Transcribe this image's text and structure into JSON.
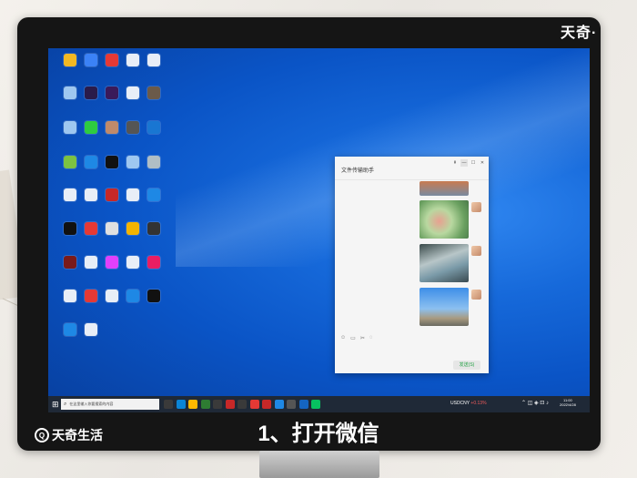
{
  "watermark_top": "天奇·",
  "watermark_bottom": "天奇生活",
  "caption": "1、打开微信",
  "desktop_icons": [
    {
      "label": "",
      "color": "#f2b823"
    },
    {
      "label": "",
      "color": "#3b82f6"
    },
    {
      "label": "",
      "color": "#e53935"
    },
    {
      "label": "",
      "color": "#e8eef7"
    },
    {
      "label": "",
      "color": "#e8eef7"
    },
    {
      "label": "",
      "color": "#9ec7f0"
    },
    {
      "label": "",
      "color": "#2a1b4a"
    },
    {
      "label": "",
      "color": "#3a1a5a"
    },
    {
      "label": "",
      "color": "#e8eef7"
    },
    {
      "label": "",
      "color": "#6b5a4a"
    },
    {
      "label": "",
      "color": "#9ec7f0"
    },
    {
      "label": "",
      "color": "#2ecc40"
    },
    {
      "label": "",
      "color": "#c08a6a"
    },
    {
      "label": "",
      "color": "#555"
    },
    {
      "label": "",
      "color": "#1976d2"
    },
    {
      "label": "",
      "color": "#7cc242"
    },
    {
      "label": "",
      "color": "#1e88e5"
    },
    {
      "label": "",
      "color": "#111"
    },
    {
      "label": "",
      "color": "#9ec7f0"
    },
    {
      "label": "",
      "color": "#b0bec5"
    },
    {
      "label": "",
      "color": "#e8eef7"
    },
    {
      "label": "",
      "color": "#e8eef7"
    },
    {
      "label": "",
      "color": "#c62828"
    },
    {
      "label": "",
      "color": "#e8eef7"
    },
    {
      "label": "",
      "color": "#1e88e5"
    },
    {
      "label": "",
      "color": "#111"
    },
    {
      "label": "",
      "color": "#e53935"
    },
    {
      "label": "",
      "color": "#e0e0e0"
    },
    {
      "label": "",
      "color": "#f4b400"
    },
    {
      "label": "",
      "color": "#333"
    },
    {
      "label": "",
      "color": "#7a1a1a"
    },
    {
      "label": "",
      "color": "#e8eef7"
    },
    {
      "label": "",
      "color": "#e040fb"
    },
    {
      "label": "",
      "color": "#e8eef7"
    },
    {
      "label": "",
      "color": "#e91e63"
    },
    {
      "label": "",
      "color": "#e8eef7"
    },
    {
      "label": "",
      "color": "#e53935"
    },
    {
      "label": "",
      "color": "#e8eef7"
    },
    {
      "label": "",
      "color": "#1e88e5"
    },
    {
      "label": "",
      "color": "#111"
    },
    {
      "label": "",
      "color": "#1e88e5"
    },
    {
      "label": "",
      "color": "#e8eef7"
    }
  ],
  "wechat_window": {
    "title": "文件传输助手",
    "controls": [
      "⇞",
      "—",
      "☐",
      "✕"
    ],
    "send_label": "发送(S)",
    "tool_icons": [
      "☺",
      "▭",
      "✂",
      "◌"
    ]
  },
  "taskbar": {
    "search_placeholder": "在这里输入你要搜索的内容",
    "stock_text": "USDCNY",
    "stock_change": "+0.13%",
    "time": "11:00",
    "date": "2022/4/28",
    "apps": [
      "#3a3a3a",
      "#0a84d6",
      "#ffb900",
      "#2e7d32",
      "#3a3a3a",
      "#c62828",
      "#3a3a3a",
      "#e53935",
      "#c62828",
      "#1e88e5",
      "#555",
      "#1565c0",
      "#07c160"
    ]
  },
  "colors": {
    "accent_send": "#23a244",
    "taskbar": "#1f2937",
    "desktop_blue": "#0a5bd0"
  }
}
